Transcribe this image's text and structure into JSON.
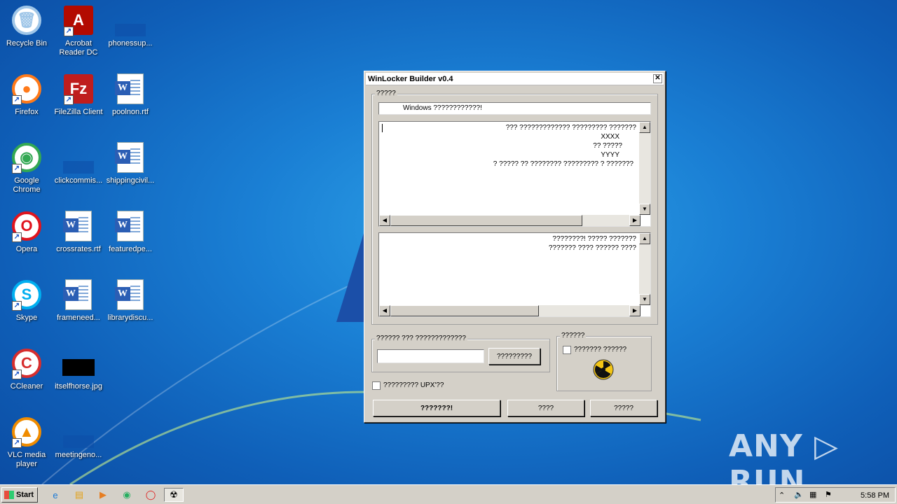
{
  "desktop": {
    "icons": [
      {
        "label": "Recycle Bin",
        "icon": "recycle-bin-icon"
      },
      {
        "label": "Acrobat Reader DC",
        "icon": "acrobat-icon"
      },
      {
        "label": "phonessup...",
        "icon": "blank-file-icon"
      },
      {
        "label": "Firefox",
        "icon": "firefox-icon"
      },
      {
        "label": "FileZilla Client",
        "icon": "filezilla-icon"
      },
      {
        "label": "poolnon.rtf",
        "icon": "word-doc-icon"
      },
      {
        "label": "Google Chrome",
        "icon": "chrome-icon"
      },
      {
        "label": "clickcommis...",
        "icon": "blank-file-icon"
      },
      {
        "label": "shippingcivil...",
        "icon": "word-doc-icon"
      },
      {
        "label": "Opera",
        "icon": "opera-icon"
      },
      {
        "label": "crossrates.rtf",
        "icon": "word-doc-icon"
      },
      {
        "label": "featuredpe...",
        "icon": "word-doc-icon"
      },
      {
        "label": "Skype",
        "icon": "skype-icon"
      },
      {
        "label": "frameneed...",
        "icon": "word-doc-icon"
      },
      {
        "label": "librarydiscu...",
        "icon": "word-doc-icon"
      },
      {
        "label": "CCleaner",
        "icon": "ccleaner-icon"
      },
      {
        "label": "itselfhorse.jpg",
        "icon": "image-file-icon"
      },
      {
        "label": "VLC media player",
        "icon": "vlc-icon"
      },
      {
        "label": "meetingeno...",
        "icon": "blank-file-icon"
      }
    ]
  },
  "window": {
    "title": "WinLocker Builder v0.4",
    "close_glyph": "✕",
    "group_text": {
      "label": "?????",
      "title_field": "Windows ????????????!",
      "memo1_lines": [
        "??? ????????????? ????????? ???????",
        "XXXX",
        "?? ?????",
        "YYYY",
        "? ????? ?? ???????? ????????? ? ???????"
      ],
      "memo2_lines": [
        "????????! ????? ???????",
        "??????? ???? ?????? ????"
      ]
    },
    "group_code": {
      "label": "?????? ??? ?????????????",
      "input_value": "",
      "button": "?????????"
    },
    "group_icon": {
      "label": "??????",
      "checkbox_label": "??????? ??????"
    },
    "upx_checkbox": "????????? UPX'??",
    "buttons": {
      "build": "???????!",
      "b2": "????",
      "b3": "?????"
    }
  },
  "taskbar": {
    "start": "Start",
    "time": "5:58 PM"
  },
  "watermark": "ANY ▷ RUN"
}
